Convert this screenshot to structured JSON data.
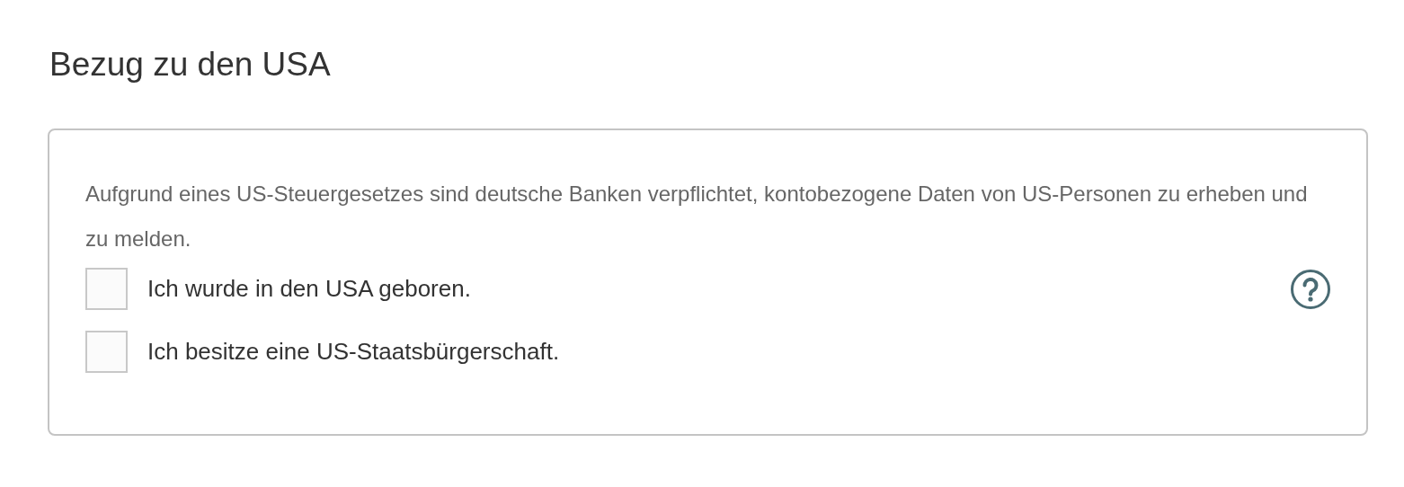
{
  "heading": "Bezug zu den USA",
  "notice": "Aufgrund eines US-Steuergesetzes sind deutsche Banken verpflichtet, kontobezogene Daten von US-Personen zu erheben und zu melden.",
  "options": [
    {
      "label": "Ich wurde in den USA geboren.",
      "checked": false
    },
    {
      "label": "Ich besitze eine US-Staatsbürgerschaft.",
      "checked": false
    }
  ]
}
